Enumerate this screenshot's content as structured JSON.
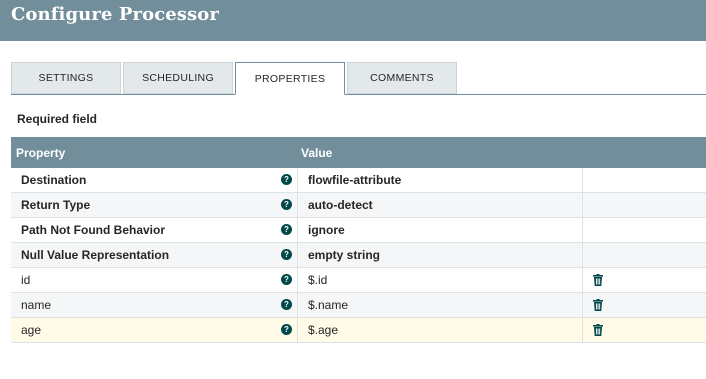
{
  "dialog": {
    "title": "Configure Processor"
  },
  "tabs": [
    {
      "label": "SETTINGS"
    },
    {
      "label": "SCHEDULING"
    },
    {
      "label": "PROPERTIES"
    },
    {
      "label": "COMMENTS"
    }
  ],
  "active_tab": "PROPERTIES",
  "required_label": "Required field",
  "table": {
    "headers": {
      "property": "Property",
      "value": "Value"
    },
    "rows": [
      {
        "name": "Destination",
        "value": "flowfile-attribute",
        "required": true,
        "help_icon": "question-circle-icon"
      },
      {
        "name": "Return Type",
        "value": "auto-detect",
        "required": true,
        "help_icon": "question-circle-icon"
      },
      {
        "name": "Path Not Found Behavior",
        "value": "ignore",
        "required": true,
        "help_icon": "question-circle-icon"
      },
      {
        "name": "Null Value Representation",
        "value": "empty string",
        "required": true,
        "help_icon": "question-circle-icon"
      },
      {
        "name": "id",
        "value": "$.id",
        "required": false,
        "help_icon": "question-circle-icon",
        "delete_icon": "trash-icon"
      },
      {
        "name": "name",
        "value": "$.name",
        "required": false,
        "help_icon": "question-circle-icon",
        "delete_icon": "trash-icon"
      },
      {
        "name": "age",
        "value": "$.age",
        "required": false,
        "selected": true,
        "help_icon": "question-circle-icon",
        "delete_icon": "trash-icon"
      }
    ]
  },
  "colors": {
    "header": "#728e9b",
    "help_icon": "#004849",
    "selected_row": "#fffbe8"
  }
}
